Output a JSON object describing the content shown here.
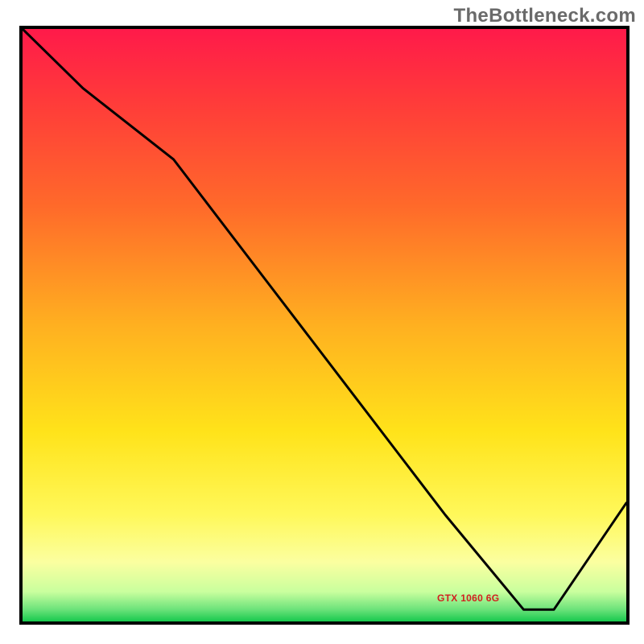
{
  "watermark": "TheBottleneck.com",
  "chart_data": {
    "type": "line",
    "title": "",
    "xlabel": "",
    "ylabel": "",
    "xlim": [
      0,
      100
    ],
    "ylim": [
      0,
      100
    ],
    "series_label": "GTX 1060 6G",
    "annotation_position": {
      "x": 78,
      "y": 3
    },
    "colors": {
      "line": "#000000",
      "label": "#d21f1f",
      "gradient_top": "#ff1a4a",
      "gradient_bottom": "#17c94d"
    },
    "x": [
      0,
      10,
      25,
      40,
      55,
      70,
      83,
      88,
      100
    ],
    "values": [
      100,
      90,
      78,
      58,
      38,
      18,
      2,
      2,
      20
    ]
  }
}
